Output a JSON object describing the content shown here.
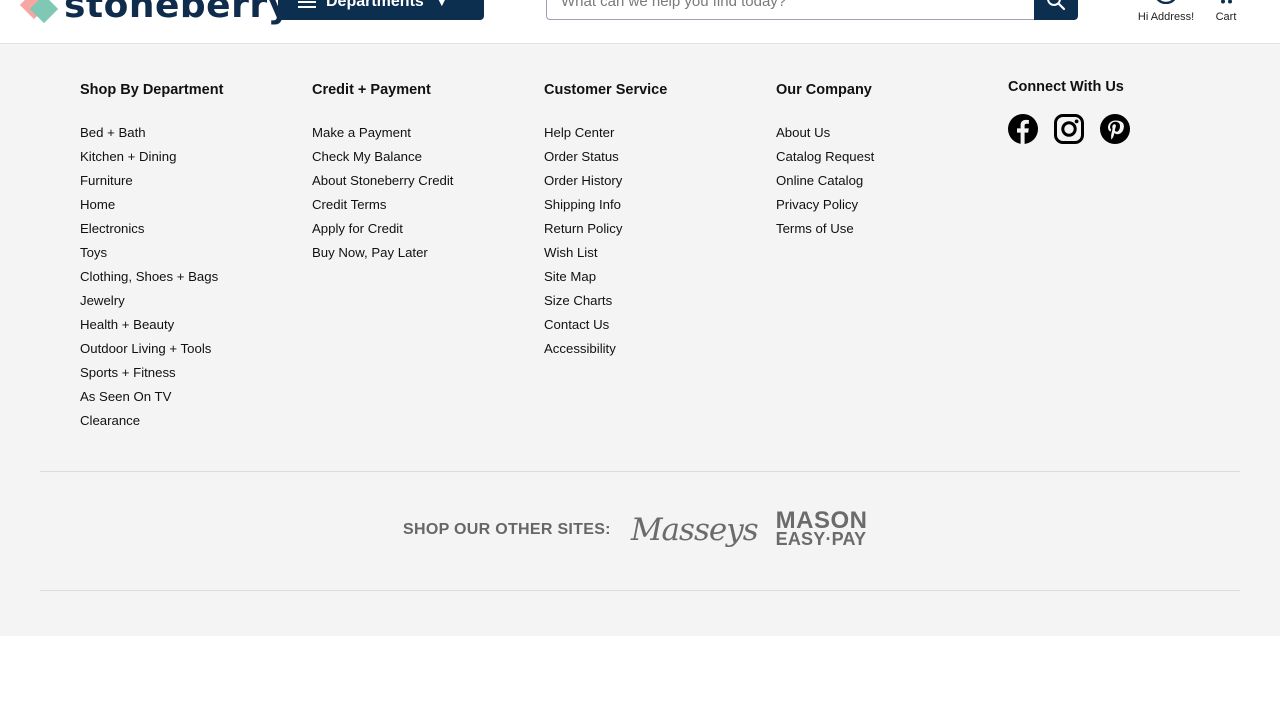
{
  "header": {
    "logo_text": "stoneberry",
    "departments_label": "Departments",
    "search_placeholder": "What can we help you find today?",
    "account_label": "Hi Address!",
    "cart_label": "Cart"
  },
  "footer": {
    "shop": {
      "title": "Shop By Department",
      "items": [
        "Bed + Bath",
        "Kitchen + Dining",
        "Furniture",
        "Home",
        "Electronics",
        "Toys",
        "Clothing, Shoes + Bags",
        "Jewelry",
        "Health + Beauty",
        "Outdoor Living + Tools",
        "Sports + Fitness",
        "As Seen On TV",
        "Clearance"
      ]
    },
    "credit": {
      "title": "Credit + Payment",
      "items": [
        "Make a Payment",
        "Check My Balance",
        "About Stoneberry Credit",
        "Credit Terms",
        "Apply for Credit",
        "Buy Now, Pay Later"
      ]
    },
    "service": {
      "title": "Customer Service",
      "items": [
        "Help Center",
        "Order Status",
        "Order History",
        "Shipping Info",
        "Return Policy",
        "Wish List",
        "Site Map",
        "Size Charts",
        "Contact Us",
        "Accessibility"
      ]
    },
    "company": {
      "title": "Our Company",
      "items": [
        "About Us",
        "Catalog Request",
        "Online Catalog",
        "Privacy Policy",
        "Terms of Use"
      ]
    },
    "connect": {
      "title": "Connect With Us",
      "icons": [
        "facebook-icon",
        "instagram-icon",
        "pinterest-icon"
      ]
    },
    "other_sites": {
      "label": "SHOP OUR OTHER SITES:",
      "sites": [
        "Masseys",
        "MASON EASY-PAY"
      ]
    }
  },
  "colors": {
    "navy": "#0c2f4f",
    "footer_bg": "#f4f4f4",
    "logo_pink": "#f4a7a3",
    "logo_teal": "#7fc8b4"
  }
}
